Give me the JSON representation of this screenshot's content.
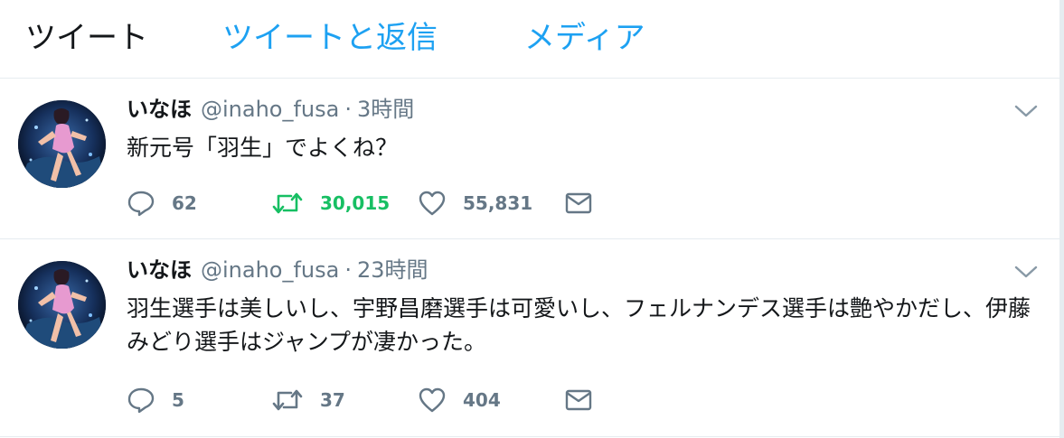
{
  "tabs": [
    {
      "label": "ツイート",
      "active": true
    },
    {
      "label": "ツイートと返信",
      "active": false
    },
    {
      "label": "メディア",
      "active": false
    }
  ],
  "colors": {
    "accent": "#1da1f2",
    "retweet_active": "#17bf63",
    "text": "#14171a",
    "muted": "#657786",
    "divider": "#e6ecf0"
  },
  "tweets": [
    {
      "name": "いなほ",
      "handle": "@inaho_fusa",
      "separator": "·",
      "time": "3時間",
      "text": "新元号「羽生」でよくね？",
      "replies": "62",
      "retweets": "30,015",
      "retweeted": true,
      "likes": "55,831",
      "icons": [
        "reply-icon",
        "retweet-icon",
        "like-icon",
        "direct-message-icon",
        "chevron-down-icon"
      ]
    },
    {
      "name": "いなほ",
      "handle": "@inaho_fusa",
      "separator": "·",
      "time": "23時間",
      "text": "羽生選手は美しいし、宇野昌磨選手は可愛いし、フェルナンデス選手は艶やかだし、伊藤みどり選手はジャンプが凄かった。",
      "replies": "5",
      "retweets": "37",
      "retweeted": false,
      "likes": "404",
      "icons": [
        "reply-icon",
        "retweet-icon",
        "like-icon",
        "direct-message-icon",
        "chevron-down-icon"
      ]
    }
  ]
}
